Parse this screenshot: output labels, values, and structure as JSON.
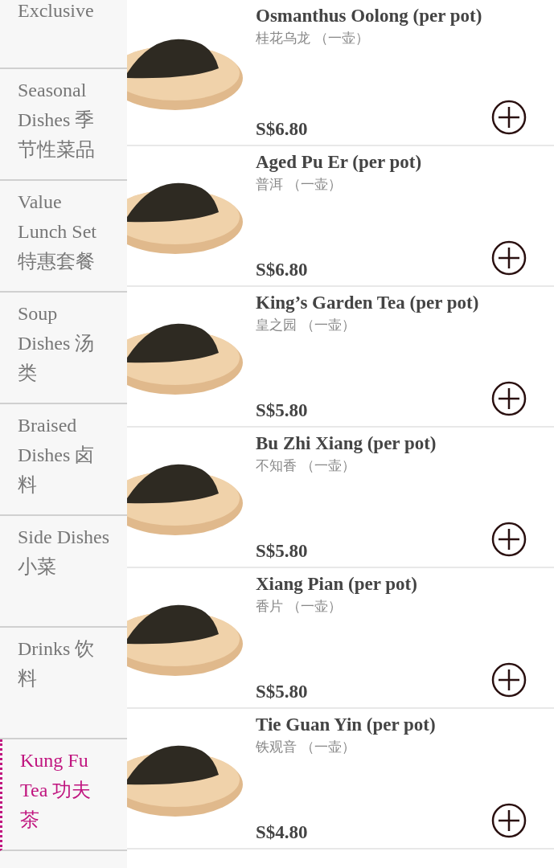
{
  "sidebar": {
    "items": [
      {
        "label": "Exclusive",
        "selected": false
      },
      {
        "label": "Seasonal Dishes 季节性菜品",
        "selected": false
      },
      {
        "label": "Value Lunch Set 特惠套餐",
        "selected": false
      },
      {
        "label": "Soup Dishes 汤类",
        "selected": false
      },
      {
        "label": "Braised Dishes 卤料",
        "selected": false
      },
      {
        "label": "Side Dishes 小菜",
        "selected": false
      },
      {
        "label": "Drinks 饮料",
        "selected": false
      },
      {
        "label": "Kung Fu Tea 功夫茶",
        "selected": true
      }
    ]
  },
  "products": [
    {
      "name": "Osmanthus Oolong (per pot)",
      "name_zh": "桂花乌龙 （一壶）",
      "price": "S$6.80"
    },
    {
      "name": "Aged Pu Er (per pot)",
      "name_zh": "普洱 （一壶）",
      "price": "S$6.80"
    },
    {
      "name": "King’s Garden Tea (per pot)",
      "name_zh": "皇之园 （一壶）",
      "price": "S$5.80"
    },
    {
      "name": "Bu Zhi Xiang (per pot)",
      "name_zh": "不知香 （一壶）",
      "price": "S$5.80"
    },
    {
      "name": "Xiang Pian (per pot)",
      "name_zh": "香片 （一壶）",
      "price": "S$5.80"
    },
    {
      "name": "Tie Guan Yin (per pot)",
      "name_zh": "铁观音 （一壶）",
      "price": "S$4.80"
    }
  ]
}
